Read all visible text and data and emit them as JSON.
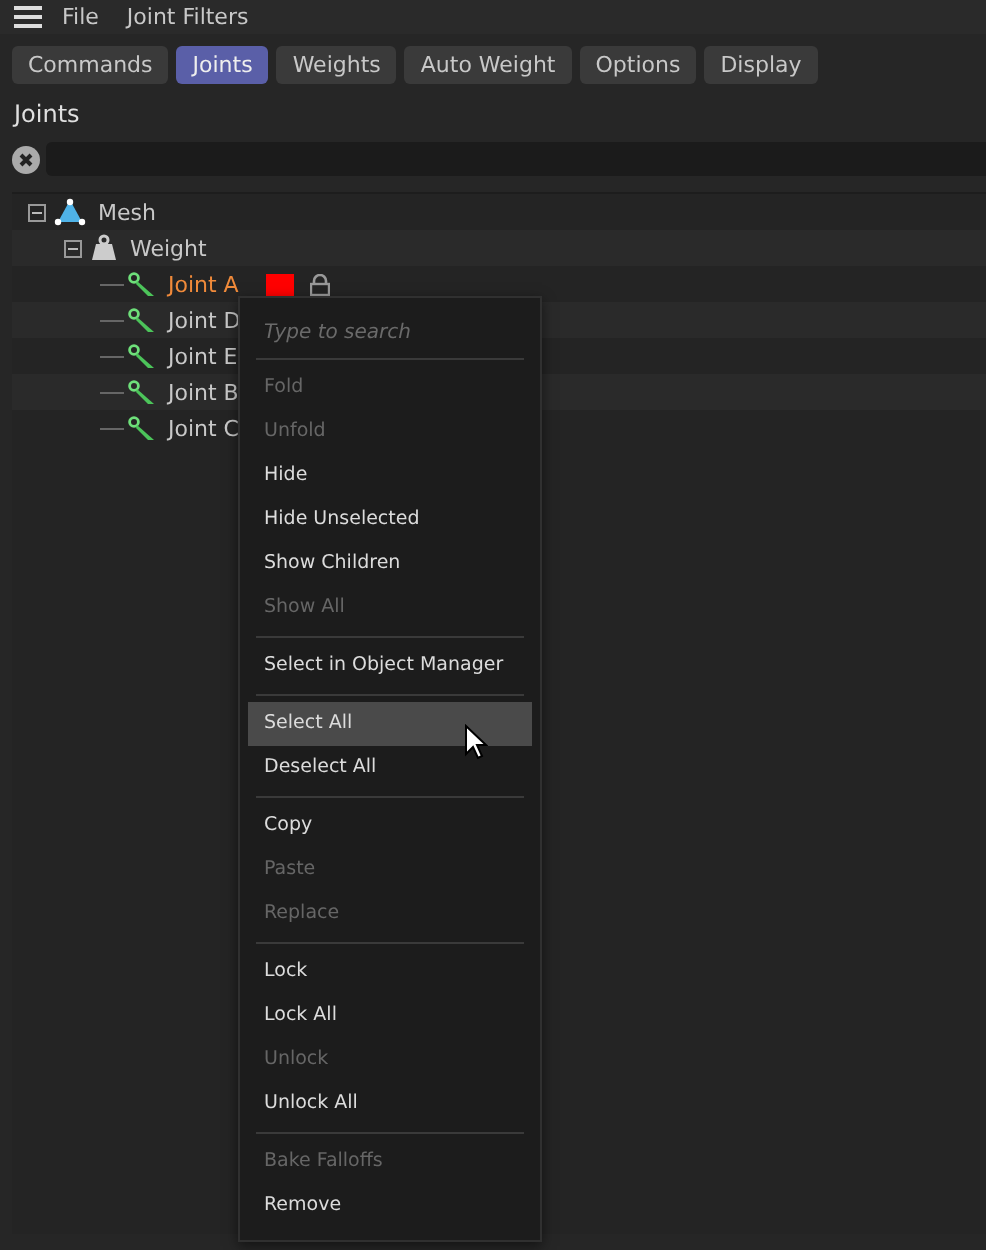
{
  "menubar": [
    "File",
    "Joint Filters"
  ],
  "tabs": [
    {
      "label": "Commands",
      "selected": false
    },
    {
      "label": "Joints",
      "selected": true
    },
    {
      "label": "Weights",
      "selected": false
    },
    {
      "label": "Auto Weight",
      "selected": false
    },
    {
      "label": "Options",
      "selected": false
    },
    {
      "label": "Display",
      "selected": false
    }
  ],
  "section_title": "Joints",
  "tree": [
    {
      "label": "Mesh",
      "kind": "mesh",
      "expanded": true,
      "selected": false,
      "children": [
        {
          "label": "Weight",
          "kind": "weight",
          "expanded": true,
          "selected": false,
          "children": [
            {
              "label": "Joint A",
              "kind": "joint",
              "selected": true,
              "color": "#ff0000"
            },
            {
              "label": "Joint D",
              "kind": "joint",
              "selected": false
            },
            {
              "label": "Joint E",
              "kind": "joint",
              "selected": false
            },
            {
              "label": "Joint B",
              "kind": "joint",
              "selected": false
            },
            {
              "label": "Joint C",
              "kind": "joint",
              "selected": false
            }
          ]
        }
      ]
    }
  ],
  "context_menu": {
    "placeholder": "Type to search",
    "items": [
      {
        "kind": "separator"
      },
      {
        "kind": "item",
        "label": "Fold",
        "disabled": true,
        "highlighted": false
      },
      {
        "kind": "item",
        "label": "Unfold",
        "disabled": true,
        "highlighted": false
      },
      {
        "kind": "item",
        "label": "Hide",
        "disabled": false,
        "highlighted": false
      },
      {
        "kind": "item",
        "label": "Hide Unselected",
        "disabled": false,
        "highlighted": false
      },
      {
        "kind": "item",
        "label": "Show Children",
        "disabled": false,
        "highlighted": false
      },
      {
        "kind": "item",
        "label": "Show All",
        "disabled": true,
        "highlighted": false
      },
      {
        "kind": "separator"
      },
      {
        "kind": "item",
        "label": "Select in Object Manager",
        "disabled": false,
        "highlighted": false
      },
      {
        "kind": "separator"
      },
      {
        "kind": "item",
        "label": "Select All",
        "disabled": false,
        "highlighted": true
      },
      {
        "kind": "item",
        "label": "Deselect All",
        "disabled": false,
        "highlighted": false
      },
      {
        "kind": "separator"
      },
      {
        "kind": "item",
        "label": "Copy",
        "disabled": false,
        "highlighted": false
      },
      {
        "kind": "item",
        "label": "Paste",
        "disabled": true,
        "highlighted": false
      },
      {
        "kind": "item",
        "label": "Replace",
        "disabled": true,
        "highlighted": false
      },
      {
        "kind": "separator"
      },
      {
        "kind": "item",
        "label": "Lock",
        "disabled": false,
        "highlighted": false
      },
      {
        "kind": "item",
        "label": "Lock All",
        "disabled": false,
        "highlighted": false
      },
      {
        "kind": "item",
        "label": "Unlock",
        "disabled": true,
        "highlighted": false
      },
      {
        "kind": "item",
        "label": "Unlock All",
        "disabled": false,
        "highlighted": false
      },
      {
        "kind": "separator"
      },
      {
        "kind": "item",
        "label": "Bake Falloffs",
        "disabled": true,
        "highlighted": false
      },
      {
        "kind": "item",
        "label": "Remove",
        "disabled": false,
        "highlighted": false
      }
    ]
  }
}
